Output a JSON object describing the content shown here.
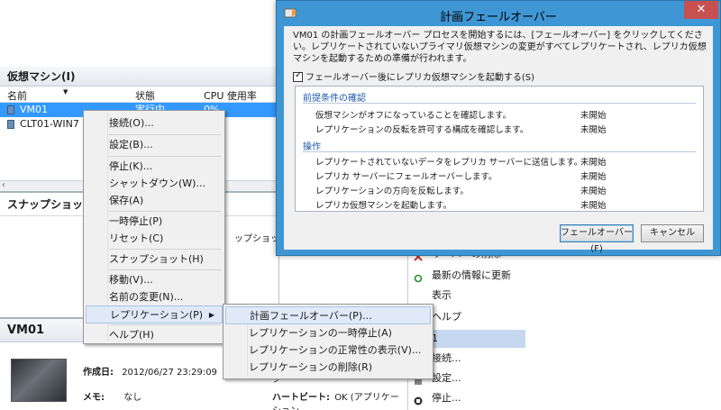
{
  "vm_list": {
    "title": "仮想マシン(I)",
    "columns": [
      "名前",
      "状態",
      "CPU 使用率"
    ],
    "rows": [
      {
        "name": "VM01",
        "state": "実行中",
        "cpu": "0%"
      },
      {
        "name": "CLT01-WIN7",
        "state": "",
        "cpu": ""
      }
    ]
  },
  "snapshot": {
    "title": "スナップショット(",
    "message": "ップショットが"
  },
  "details": {
    "title": "VM01",
    "created_label": "作成日:",
    "created_value": "2012/06/27 23:29:09",
    "memo_label": "メモ:",
    "memo_value": "なし",
    "cluster_label": "ク",
    "heartbeat_label": "ハートビート:",
    "heartbeat_value": "OK (アプリケーション"
  },
  "actions": {
    "items": [
      "サーバーの削除",
      "最新の情報に更新",
      "表示",
      "ヘルプ",
      "1",
      "接続...",
      "設定...",
      "停止..."
    ]
  },
  "context_menu": {
    "items": [
      "接続(O)...",
      "設定(B)...",
      "停止(K)...",
      "シャットダウン(W)...",
      "保存(A)",
      "一時停止(P)",
      "リセット(C)",
      "スナップショット(H)",
      "移動(V)...",
      "名前の変更(N)...",
      "レプリケーション(P)",
      "ヘルプ(H)"
    ],
    "highlighted": "レプリケーション(P)"
  },
  "submenu": {
    "items": [
      "計画フェールオーバー(P)...",
      "レプリケーションの一時停止(A)",
      "レプリケーションの正常性の表示(V)...",
      "レプリケーションの削除(R)"
    ],
    "highlighted": "計画フェールオーバー(P)..."
  },
  "dialog": {
    "title": "計画フェールオーバー",
    "close_label": "✕",
    "description": "VM01 の計画フェールオーバー プロセスを開始するには、[フェールオーバー] をクリックしてください。レプリケートされていないプライマリ仮想マシンの変更がすべてレプリケートされ、レプリカ仮想マシンを起動するための準備が行われます。",
    "checkbox_label": "フェールオーバー後にレプリカ仮想マシンを起動する(S)",
    "checkbox_checked": true,
    "sections": [
      {
        "title": "前提条件の確認",
        "steps": [
          {
            "label": "仮想マシンがオフになっていることを確認します。",
            "status": "未開始"
          },
          {
            "label": "レプリケーションの反転を許可する構成を確認します。",
            "status": "未開始"
          }
        ]
      },
      {
        "title": "操作",
        "steps": [
          {
            "label": "レプリケートされていないデータをレプリカ サーバーに送信します。",
            "status": "未開始"
          },
          {
            "label": "レプリカ サーバーにフェールオーバーします。",
            "status": "未開始"
          },
          {
            "label": "レプリケーションの方向を反転します。",
            "status": "未開始"
          },
          {
            "label": "レプリカ仮想マシンを起動します。",
            "status": "未開始"
          }
        ]
      }
    ],
    "failover_button": "フェールオーバー(F)",
    "cancel_button": "キャンセル"
  },
  "colors": {
    "dialog_frame": "#3f96d4",
    "close_button": "#c75050",
    "selection": "#3399ff",
    "section_heading": "#1c58a8"
  }
}
